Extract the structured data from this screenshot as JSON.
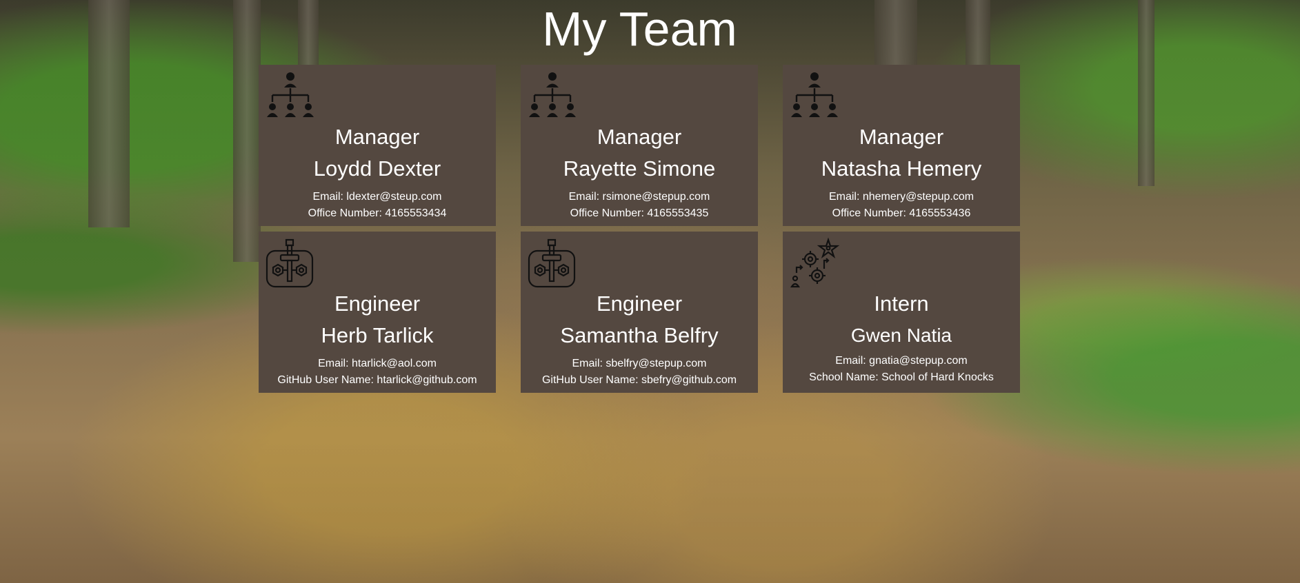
{
  "page": {
    "title": "My Team"
  },
  "cards": [
    {
      "role": "Manager",
      "name": "Loydd Dexter",
      "email": "Email: ldexter@steup.com",
      "extra": "Office Number: 4165553434",
      "icon": "org-chart-icon"
    },
    {
      "role": "Manager",
      "name": "Rayette Simone",
      "email": "Email: rsimone@stepup.com",
      "extra": "Office Number: 4165553435",
      "icon": "org-chart-icon"
    },
    {
      "role": "Manager",
      "name": "Natasha Hemery",
      "email": "Email: nhemery@stepup.com",
      "extra": "Office Number: 4165553436",
      "icon": "org-chart-icon"
    },
    {
      "role": "Engineer",
      "name": "Herb Tarlick",
      "email": "Email: htarlick@aol.com",
      "extra": "GitHub User Name: htarlick@github.com",
      "icon": "engineering-tool-icon"
    },
    {
      "role": "Engineer",
      "name": "Samantha Belfry",
      "email": "Email: sbelfry@stepup.com",
      "extra": "GitHub User Name: sbefry@github.com",
      "icon": "engineering-tool-icon"
    },
    {
      "role": "Intern",
      "name": "Gwen Natia",
      "email": "Email: gnatia@stepup.com",
      "extra": "School Name: School of Hard Knocks",
      "icon": "career-growth-icon"
    }
  ],
  "colors": {
    "card_background": "#544840",
    "text": "#ffffff",
    "icon": "#111111"
  }
}
